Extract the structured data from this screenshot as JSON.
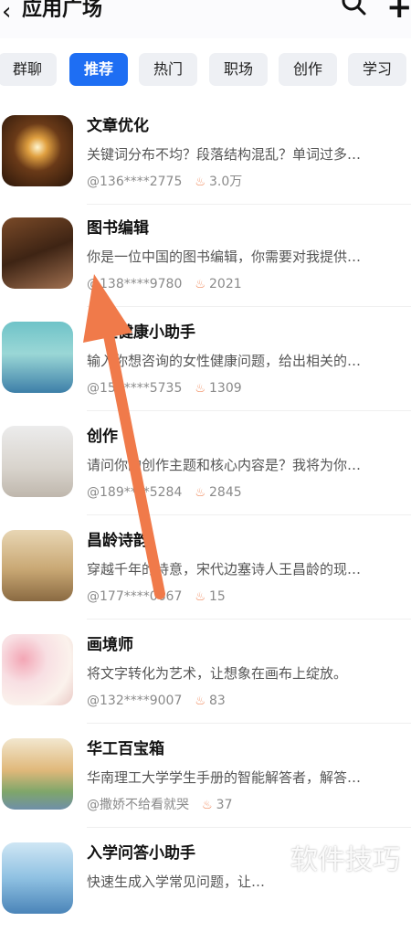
{
  "header": {
    "back_icon": "back-chevron-icon",
    "title": "应用广场",
    "search_icon": "search-icon",
    "add_icon": "plus-icon"
  },
  "tabs": [
    {
      "label": "群聊",
      "active": false
    },
    {
      "label": "推荐",
      "active": true
    },
    {
      "label": "热门",
      "active": false
    },
    {
      "label": "职场",
      "active": false
    },
    {
      "label": "创作",
      "active": false
    },
    {
      "label": "学习",
      "active": false
    }
  ],
  "apps": [
    {
      "title": "文章优化",
      "desc": "关键词分布不均？段落结构混乱？单词过多…",
      "author": "@136****2775",
      "heat": "3.0万"
    },
    {
      "title": "图书编辑",
      "desc": "你是一位中国的图书编辑，你需要对我提供…",
      "author": "@138****9780",
      "heat": "2021"
    },
    {
      "title": "女性健康小助手",
      "desc": "输入你想咨询的女性健康问题，给出相关的…",
      "author": "@152****5735",
      "heat": "1309"
    },
    {
      "title": "创作",
      "desc": "请问你的创作主题和核心内容是？我将为你…",
      "author": "@189****5284",
      "heat": "2845"
    },
    {
      "title": "昌龄诗韵",
      "desc": "穿越千年的诗意，宋代边塞诗人王昌龄的现…",
      "author": "@177****0667",
      "heat": "15"
    },
    {
      "title": "画境师",
      "desc": "将文字转化为艺术，让想象在画布上绽放。",
      "author": "@132****9007",
      "heat": "83"
    },
    {
      "title": "华工百宝箱",
      "desc": "华南理工大学学生手册的智能解答者，解答…",
      "author": "@撒娇不给看就哭",
      "heat": "37"
    },
    {
      "title": "入学问答小助手",
      "desc": "快速生成入学常见问题，让…",
      "author": "",
      "heat": ""
    }
  ],
  "watermark": "软件技巧",
  "colors": {
    "accent": "#1e6ef3",
    "arrow": "#f07a4a",
    "fire": "#f08a5d"
  }
}
